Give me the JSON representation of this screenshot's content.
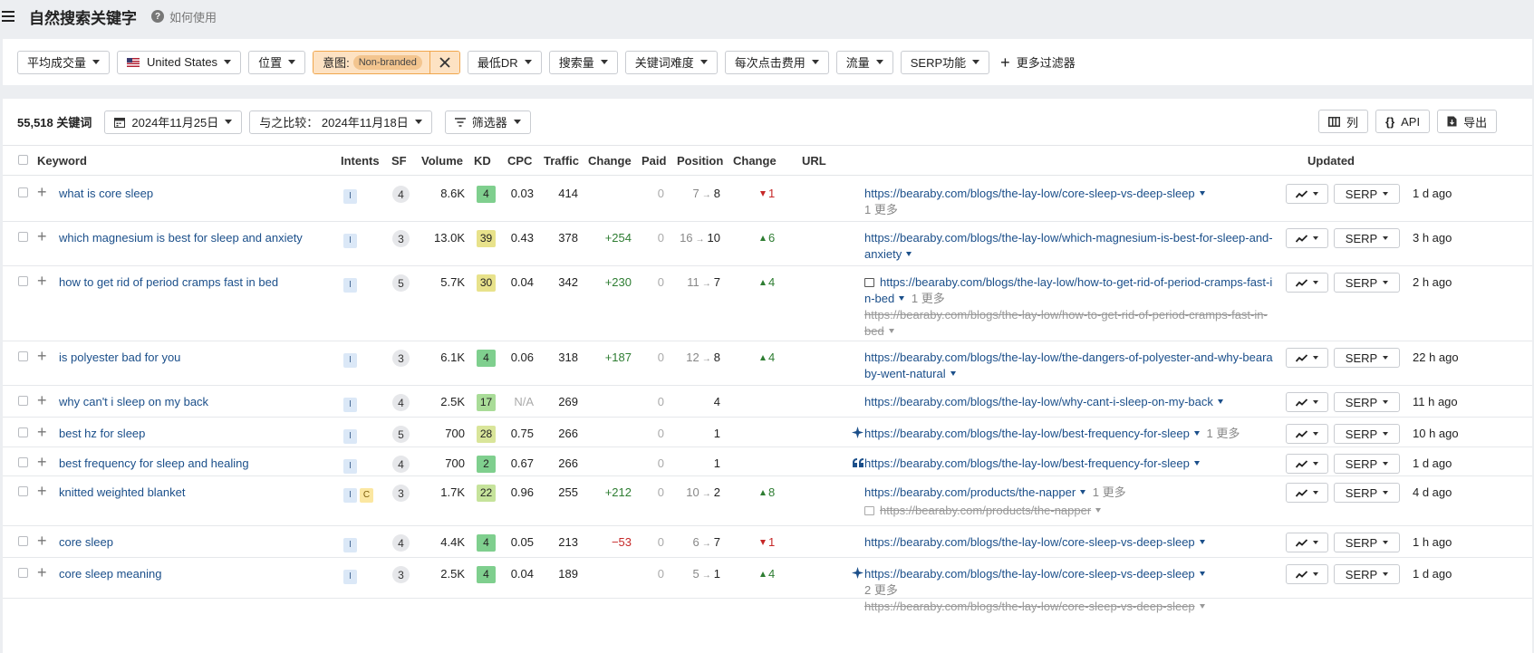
{
  "header": {
    "title": "自然搜索关键字",
    "help_label": "如何使用"
  },
  "filters": {
    "avg_deal": "平均成交量",
    "country": "United States",
    "position": "位置",
    "intent_label": "意图:",
    "intent_value": "Non-branded",
    "min_dr": "最低DR",
    "volume": "搜索量",
    "kd": "关键词难度",
    "cpc": "每次点击费用",
    "traffic": "流量",
    "serp_features": "SERP功能",
    "more_filters": "更多过滤器"
  },
  "toolbar": {
    "keyword_count": "55,518 关键词",
    "date": "2024年11月25日",
    "compare": "与之比较： 2024年11月18日",
    "filter": "筛选器",
    "columns": "列",
    "api": "API",
    "export": "导出"
  },
  "table": {
    "columns": {
      "keyword": "Keyword",
      "intents": "Intents",
      "sf": "SF",
      "volume": "Volume",
      "kd": "KD",
      "cpc": "CPC",
      "traffic": "Traffic",
      "change": "Change",
      "paid": "Paid",
      "position": "Position",
      "pos_change": "Change",
      "url": "URL",
      "updated": "Updated"
    },
    "serp_label": "SERP",
    "rows": [
      {
        "keyword": "what is core sleep",
        "intents": [
          "I"
        ],
        "sf": "4",
        "volume": "8.6K",
        "kd": "4",
        "kd_color": "#7fcf8e",
        "cpc": "0.03",
        "traffic": "414",
        "change": "",
        "paid": "0",
        "pos_old": "7",
        "pos_new": "8",
        "pos_change": "1",
        "pos_dir": "down",
        "url_prefix": "",
        "url": "https://bearaby.com/blogs/the-lay-low/core-sleep-vs-deep-sleep",
        "url_more": "1 更多",
        "url_old": "",
        "updated": "1 d ago"
      },
      {
        "keyword": "which magnesium is best for sleep and anxiety",
        "intents": [
          "I"
        ],
        "sf": "3",
        "volume": "13.0K",
        "kd": "39",
        "kd_color": "#e8e28b",
        "cpc": "0.43",
        "traffic": "378",
        "change": "+254",
        "paid": "0",
        "pos_old": "16",
        "pos_new": "10",
        "pos_change": "6",
        "pos_dir": "up",
        "url_prefix": "",
        "url": "https://bearaby.com/blogs/the-lay-low/which-magnesium-is-best-for-sleep-and-anxiety",
        "url_more": "",
        "url_old": "",
        "updated": "3 h ago"
      },
      {
        "keyword": "how to get rid of period cramps fast in bed",
        "intents": [
          "I"
        ],
        "sf": "5",
        "volume": "5.7K",
        "kd": "30",
        "kd_color": "#e8e28b",
        "cpc": "0.04",
        "traffic": "342",
        "change": "+230",
        "paid": "0",
        "pos_old": "11",
        "pos_new": "7",
        "pos_change": "4",
        "pos_dir": "up",
        "url_prefix": "image",
        "url": "https://bearaby.com/blogs/the-lay-low/how-to-get-rid-of-period-cramps-fast-in-bed",
        "url_more": "1 更多",
        "url_old": "https://bearaby.com/blogs/the-lay-low/how-to-get-rid-of-period-cramps-fast-in-bed",
        "updated": "2 h ago"
      },
      {
        "keyword": "is polyester bad for you",
        "intents": [
          "I"
        ],
        "sf": "3",
        "volume": "6.1K",
        "kd": "4",
        "kd_color": "#7fcf8e",
        "cpc": "0.06",
        "traffic": "318",
        "change": "+187",
        "paid": "0",
        "pos_old": "12",
        "pos_new": "8",
        "pos_change": "4",
        "pos_dir": "up",
        "url_prefix": "",
        "url": "https://bearaby.com/blogs/the-lay-low/the-dangers-of-polyester-and-why-bearaby-went-natural",
        "url_more": "",
        "url_old": "",
        "updated": "22 h ago"
      },
      {
        "keyword": "why can't i sleep on my back",
        "intents": [
          "I"
        ],
        "sf": "4",
        "volume": "2.5K",
        "kd": "17",
        "kd_color": "#a9dc98",
        "cpc": "N/A",
        "traffic": "269",
        "change": "",
        "paid": "0",
        "pos_old": "",
        "pos_new": "4",
        "pos_change": "",
        "pos_dir": "",
        "url_prefix": "",
        "url": "https://bearaby.com/blogs/the-lay-low/why-cant-i-sleep-on-my-back",
        "url_more": "",
        "url_old": "",
        "updated": "11 h ago"
      },
      {
        "keyword": "best hz for sleep",
        "intents": [
          "I"
        ],
        "sf": "5",
        "volume": "700",
        "kd": "28",
        "kd_color": "#d9e59a",
        "cpc": "0.75",
        "traffic": "266",
        "change": "",
        "paid": "0",
        "pos_old": "",
        "pos_new": "1",
        "pos_change": "",
        "pos_dir": "",
        "url_prefix": "",
        "feature_icon": "sparkle-icon",
        "url": "https://bearaby.com/blogs/the-lay-low/best-frequency-for-sleep",
        "url_more": "1 更多",
        "url_old": "",
        "updated": "10 h ago"
      },
      {
        "keyword": "best frequency for sleep and healing",
        "intents": [
          "I"
        ],
        "sf": "4",
        "volume": "700",
        "kd": "2",
        "kd_color": "#7fcf8e",
        "cpc": "0.67",
        "traffic": "266",
        "change": "",
        "paid": "0",
        "pos_old": "",
        "pos_new": "1",
        "pos_change": "",
        "pos_dir": "",
        "url_prefix": "",
        "feature_icon": "quote-icon",
        "url": "https://bearaby.com/blogs/the-lay-low/best-frequency-for-sleep",
        "url_more": "",
        "url_old": "",
        "updated": "1 d ago"
      },
      {
        "keyword": "knitted weighted blanket",
        "intents": [
          "I",
          "C"
        ],
        "sf": "3",
        "volume": "1.7K",
        "kd": "22",
        "kd_color": "#c6e39b",
        "cpc": "0.96",
        "traffic": "255",
        "change": "+212",
        "paid": "0",
        "pos_old": "10",
        "pos_new": "2",
        "pos_change": "8",
        "pos_dir": "up",
        "url_prefix": "",
        "url": "https://bearaby.com/products/the-napper",
        "url_more": "1 更多",
        "url_old_img": "https://bearaby.com/products/the-napper",
        "url_old": "",
        "updated": "4 d ago"
      },
      {
        "keyword": "core sleep",
        "intents": [
          "I"
        ],
        "sf": "4",
        "volume": "4.4K",
        "kd": "4",
        "kd_color": "#7fcf8e",
        "cpc": "0.05",
        "traffic": "213",
        "change": "−53",
        "paid": "0",
        "pos_old": "6",
        "pos_new": "7",
        "pos_change": "1",
        "pos_dir": "down",
        "url_prefix": "",
        "url": "https://bearaby.com/blogs/the-lay-low/core-sleep-vs-deep-sleep",
        "url_more": "",
        "url_old": "",
        "updated": "1 h ago"
      },
      {
        "keyword": "core sleep meaning",
        "intents": [
          "I"
        ],
        "sf": "3",
        "volume": "2.5K",
        "kd": "4",
        "kd_color": "#7fcf8e",
        "cpc": "0.04",
        "traffic": "189",
        "change": "",
        "paid": "0",
        "pos_old": "5",
        "pos_new": "1",
        "pos_change": "4",
        "pos_dir": "up",
        "url_prefix": "",
        "feature_icon": "sparkle-icon",
        "url": "https://bearaby.com/blogs/the-lay-low/core-sleep-vs-deep-sleep",
        "url_more": "2 更多",
        "url_old": "https://bearaby.com/blogs/the-lay-low/core-sleep-vs-deep-sleep",
        "updated": "1 d ago"
      }
    ]
  },
  "colors": {
    "link": "#1b4f8a",
    "up": "#2e7d32",
    "down": "#c62828",
    "intent_filter_bg": "#fde2c3"
  }
}
